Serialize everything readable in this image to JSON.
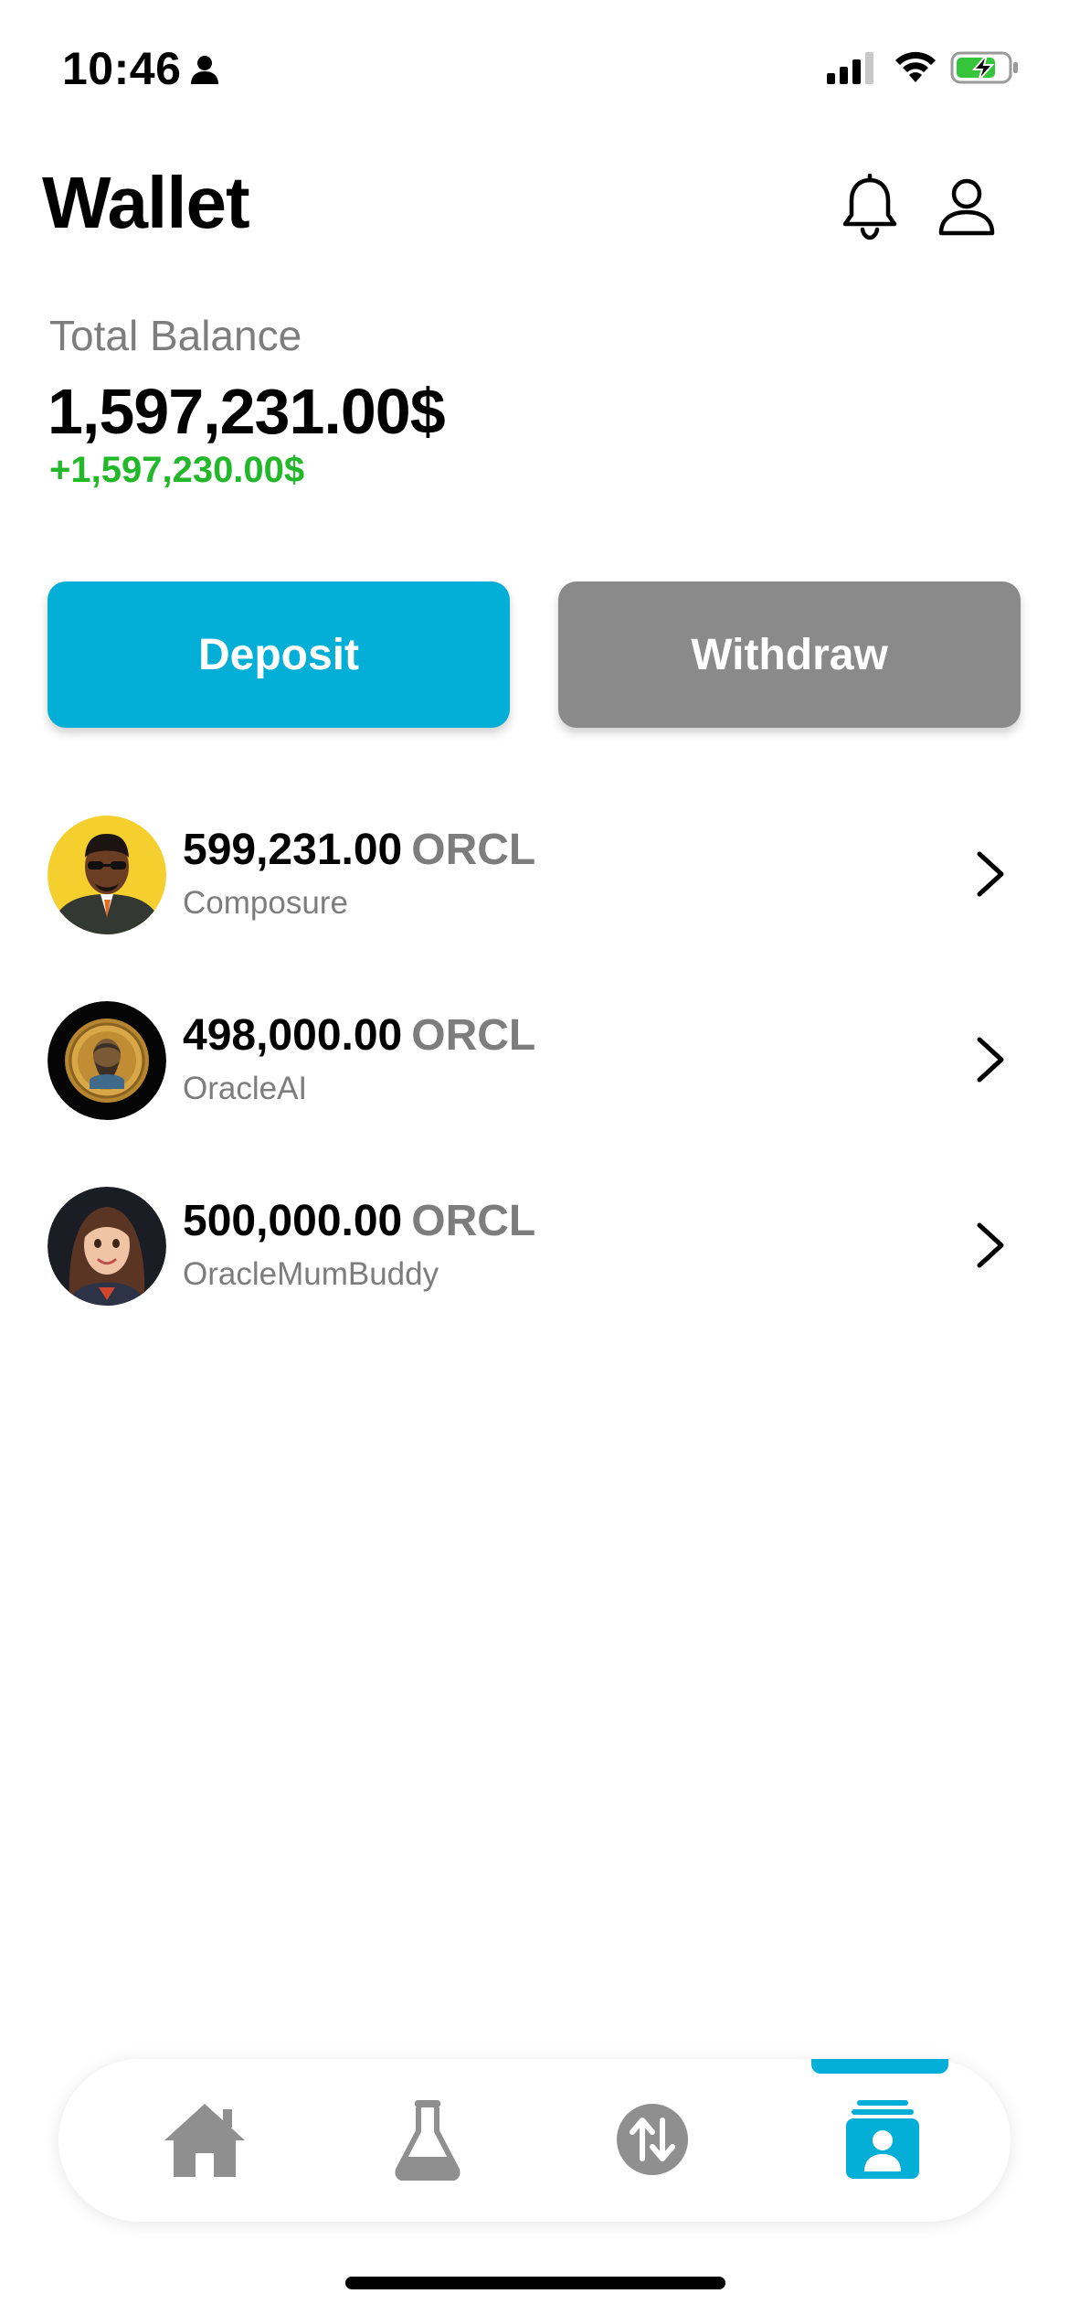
{
  "status_bar": {
    "time": "10:46"
  },
  "header": {
    "title": "Wallet"
  },
  "balance": {
    "label": "Total Balance",
    "value": "1,597,231.00$",
    "change": "+1,597,230.00$"
  },
  "actions": {
    "deposit_label": "Deposit",
    "withdraw_label": "Withdraw"
  },
  "wallets": [
    {
      "amount": "599,231.00",
      "unit": "ORCL",
      "name": "Composure"
    },
    {
      "amount": "498,000.00",
      "unit": "ORCL",
      "name": "OracleAI"
    },
    {
      "amount": "500,000.00",
      "unit": "ORCL",
      "name": "OracleMumBuddy"
    }
  ],
  "icons": {
    "bell": "bell-icon",
    "profile": "user-icon",
    "chevron": "chevron-right-icon",
    "tabs": [
      "home-icon",
      "flask-icon",
      "swap-icon",
      "wallet-card-icon"
    ]
  },
  "colors": {
    "accent": "#03afd6",
    "withdraw": "#8a8a8a",
    "positive": "#22b82a",
    "muted": "#7d7d7d",
    "inactive_tab": "#8f8f8f"
  },
  "tabs": {
    "active_index": 3
  }
}
